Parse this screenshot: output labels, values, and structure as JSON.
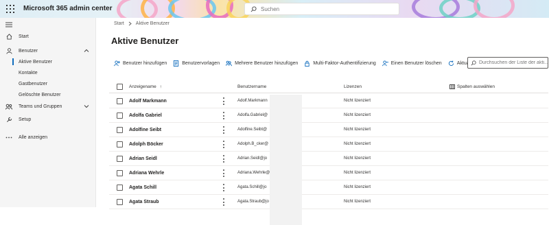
{
  "topbar": {
    "app_title": "Microsoft 365 admin center",
    "search_placeholder": "Suchen"
  },
  "sidebar": {
    "items": [
      {
        "label": "Start",
        "icon": "home-icon"
      },
      {
        "label": "Benutzer",
        "icon": "person-icon",
        "expanded": true
      },
      {
        "label": "Aktive Benutzer",
        "active": true
      },
      {
        "label": "Kontakte"
      },
      {
        "label": "Gastbenutzer"
      },
      {
        "label": "Gelöschte Benutzer"
      },
      {
        "label": "Teams und Gruppen",
        "icon": "teams-icon"
      },
      {
        "label": "Setup",
        "icon": "wrench-icon"
      },
      {
        "label": "Alle anzeigen",
        "icon": "more-icon"
      }
    ]
  },
  "breadcrumb": {
    "root": "Start",
    "current": "Aktive Benutzer"
  },
  "page_title": "Aktive Benutzer",
  "toolbar": {
    "add_user": "Benutzer hinzufügen",
    "templates": "Benutzervorlagen",
    "add_multiple": "Mehrere Benutzer hinzufügen",
    "mfa": "Multi-Faktor-Authentifizierung",
    "delete_user": "Einen Benutzer löschen",
    "refresh": "Aktualisieren",
    "search_placeholder": "Durchsuchen der Liste der akti..."
  },
  "table": {
    "headers": {
      "display_name": "Anzeigename",
      "sort_arrow": "↑",
      "username": "Benutzername",
      "licenses": "Lizenzen",
      "choose_columns": "Spalten auswählen"
    },
    "rows": [
      {
        "name": "Adolf Markmann",
        "username": "Adolf.Markmann",
        "license": "Nicht lizenziert"
      },
      {
        "name": "Adolfa Gabriel",
        "username": "Adolfa.Gabriel@",
        "license": "Nicht lizenziert"
      },
      {
        "name": "Adolfine Seibt",
        "username": "Adolfine.Seibt@",
        "license": "Nicht lizenziert"
      },
      {
        "name": "Adolph Böcker",
        "username": "Adolph.B_cker@",
        "license": "Nicht lizenziert"
      },
      {
        "name": "Adrian Seidl",
        "username": "Adrian.Seidl@jo",
        "license": "Nicht lizenziert"
      },
      {
        "name": "Adriana Wehrle",
        "username": "Adriana.Wehrle@",
        "license": "Nicht lizenziert"
      },
      {
        "name": "Agata Schill",
        "username": "Agata.Schill@jo",
        "license": "Nicht lizenziert"
      },
      {
        "name": "Agata Straub",
        "username": "Agata.Straub@jo",
        "license": "Nicht lizenziert"
      }
    ]
  },
  "colors": {
    "accent": "#0f6cbd",
    "sidebar_bg": "#f5f5f5"
  }
}
